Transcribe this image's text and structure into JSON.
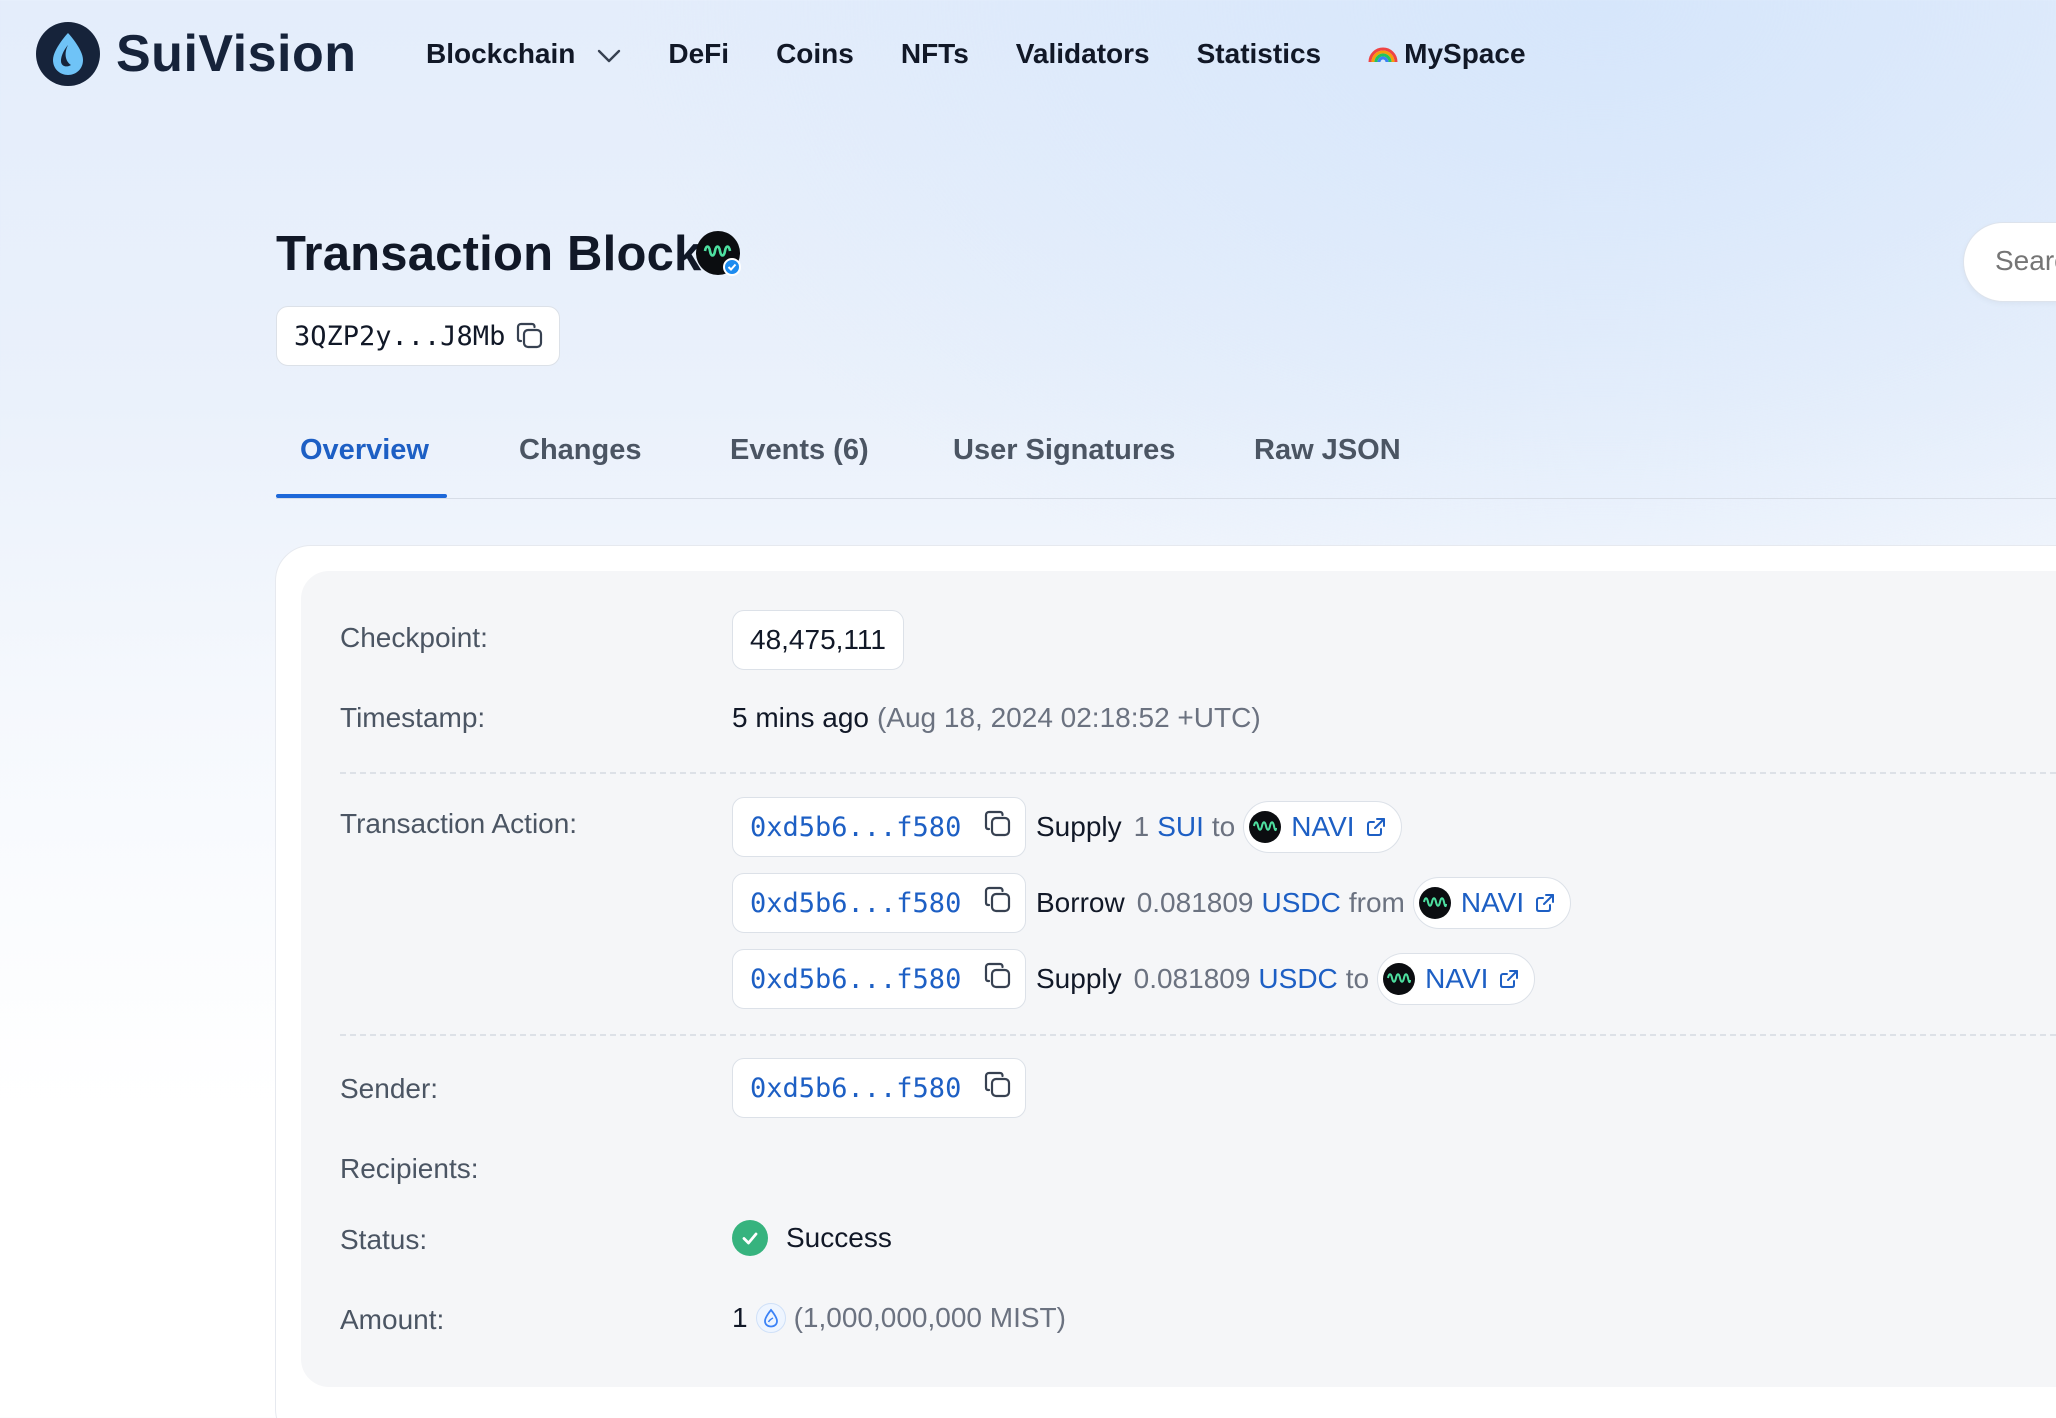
{
  "brand": {
    "name": "SuiVision"
  },
  "nav": {
    "blockchain": "Blockchain",
    "defi": "DeFi",
    "coins": "Coins",
    "nfts": "NFTs",
    "validators": "Validators",
    "statistics": "Statistics",
    "myspace": "MySpace"
  },
  "page": {
    "title": "Transaction Block",
    "digest": "3QZP2y...J8Mb"
  },
  "search": {
    "placeholder": "Search"
  },
  "tabs": [
    "Overview",
    "Changes",
    "Events (6)",
    "User Signatures",
    "Raw JSON"
  ],
  "active_tab": "Overview",
  "details": {
    "checkpoint_label": "Checkpoint:",
    "checkpoint_value": "48,475,111",
    "timestamp_label": "Timestamp:",
    "timestamp_relative": "5 mins ago",
    "timestamp_absolute": "(Aug 18, 2024 02:18:52 +UTC)",
    "action_label": "Transaction Action:",
    "actions": [
      {
        "address": "0xd5b6...f580",
        "verb": "Supply",
        "amount": "1",
        "token": "SUI",
        "preposition": "to",
        "protocol": "NAVI"
      },
      {
        "address": "0xd5b6...f580",
        "verb": "Borrow",
        "amount": "0.081809",
        "token": "USDC",
        "preposition": "from",
        "protocol": "NAVI"
      },
      {
        "address": "0xd5b6...f580",
        "verb": "Supply",
        "amount": "0.081809",
        "token": "USDC",
        "preposition": "to",
        "protocol": "NAVI"
      }
    ],
    "sender_label": "Sender:",
    "sender_address": "0xd5b6...f580",
    "recipients_label": "Recipients:",
    "status_label": "Status:",
    "status_value": "Success",
    "amount_label": "Amount:",
    "amount_value": "1",
    "amount_mist": "(1,000,000,000 MIST)"
  },
  "colors": {
    "accent": "#1d5fc4",
    "success": "#36b37e",
    "navi_green": "#4ee0a0"
  },
  "icons": [
    "sui-drop-icon",
    "chevron-down-icon",
    "rainbow-icon",
    "navi-logo-icon",
    "verified-badge-icon",
    "copy-icon",
    "external-link-icon",
    "check-icon",
    "sui-coin-icon"
  ]
}
